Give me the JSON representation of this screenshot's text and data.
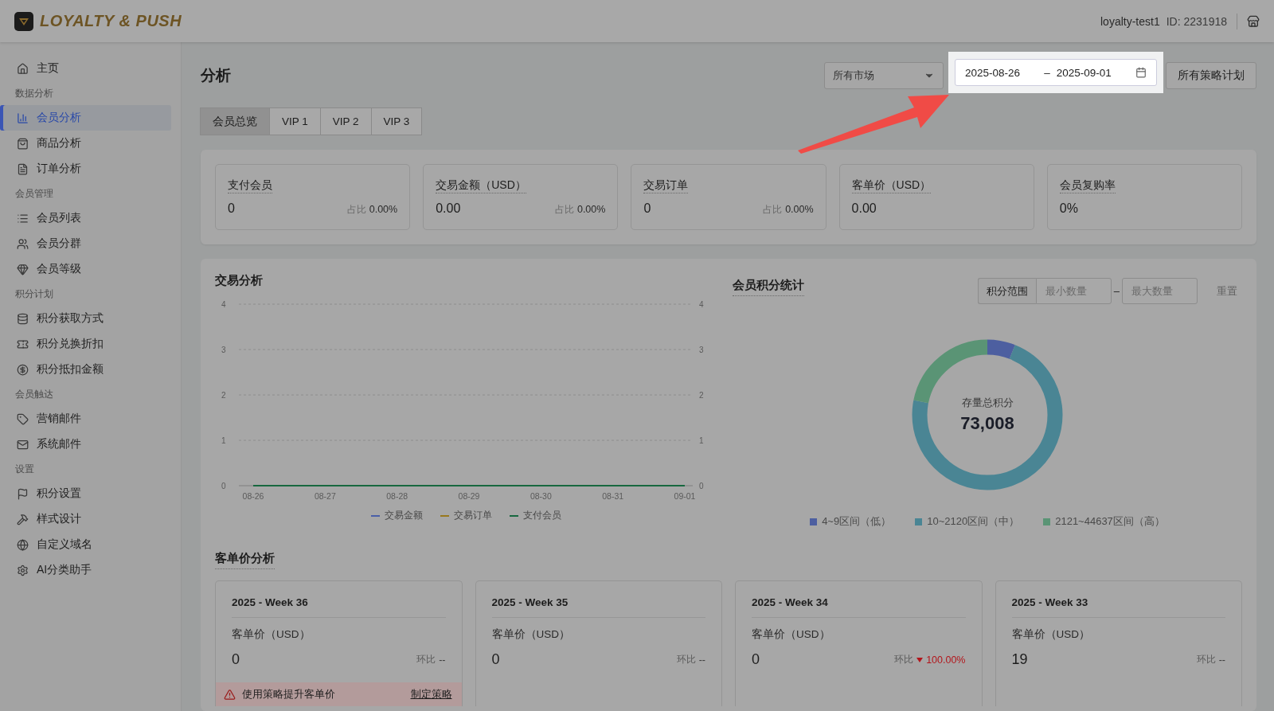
{
  "header": {
    "brand": "LOYALTY & PUSH",
    "account": "loyalty-test1",
    "account_id": "ID: 2231918"
  },
  "sidebar": {
    "sections": [
      {
        "items": [
          {
            "label": "主页",
            "selected": false
          }
        ]
      },
      {
        "label": "数据分析",
        "items": [
          {
            "label": "会员分析",
            "selected": true
          },
          {
            "label": "商品分析",
            "selected": false
          },
          {
            "label": "订单分析",
            "selected": false
          }
        ]
      },
      {
        "label": "会员管理",
        "items": [
          {
            "label": "会员列表",
            "selected": false
          },
          {
            "label": "会员分群",
            "selected": false
          },
          {
            "label": "会员等级",
            "selected": false
          }
        ]
      },
      {
        "label": "积分计划",
        "items": [
          {
            "label": "积分获取方式",
            "selected": false
          },
          {
            "label": "积分兑换折扣",
            "selected": false
          },
          {
            "label": "积分抵扣金额",
            "selected": false
          }
        ]
      },
      {
        "label": "会员触达",
        "items": [
          {
            "label": "营销邮件",
            "selected": false
          },
          {
            "label": "系统邮件",
            "selected": false
          }
        ]
      },
      {
        "label": "设置",
        "items": [
          {
            "label": "积分设置",
            "selected": false
          },
          {
            "label": "样式设计",
            "selected": false
          },
          {
            "label": "自定义域名",
            "selected": false
          },
          {
            "label": "AI分类助手",
            "selected": false
          }
        ]
      }
    ]
  },
  "page": {
    "title": "分析",
    "market_select": "所有市场",
    "date_start": "2025-08-26",
    "date_separator": "–",
    "date_end": "2025-09-01",
    "plan_button": "所有策略计划"
  },
  "tabs": [
    {
      "label": "会员总览",
      "selected": true
    },
    {
      "label": "VIP 1",
      "selected": false
    },
    {
      "label": "VIP 2",
      "selected": false
    },
    {
      "label": "VIP 3",
      "selected": false
    }
  ],
  "kpis": [
    {
      "label": "支付会员",
      "value": "0",
      "share_label": "占比",
      "share": "0.00%"
    },
    {
      "label": "交易金额（USD）",
      "value": "0.00",
      "share_label": "占比",
      "share": "0.00%"
    },
    {
      "label": "交易订单",
      "value": "0",
      "share_label": "占比",
      "share": "0.00%"
    },
    {
      "label": "客单价（USD）",
      "value": "0.00"
    },
    {
      "label": "会员复购率",
      "value": "0%"
    }
  ],
  "transactions": {
    "title": "交易分析",
    "right_axis_ticks": [
      "4",
      "3",
      "2",
      "1",
      "0"
    ],
    "chart_data": {
      "type": "line",
      "grid": true,
      "categories": [
        "08-26",
        "08-27",
        "08-28",
        "08-29",
        "08-30",
        "08-31",
        "09-01"
      ],
      "ylim": [
        0,
        4
      ],
      "yticks": [
        0,
        1,
        2,
        3,
        4
      ],
      "series": [
        {
          "name": "支付会员",
          "color": "#17683f",
          "values": [
            0,
            0,
            0,
            0,
            0,
            0,
            0
          ]
        }
      ]
    },
    "legend": [
      {
        "label": "交易金额",
        "color": "#4a5fa8"
      },
      {
        "label": "交易订单",
        "color": "#98781c"
      }
    ]
  },
  "points": {
    "title": "会员积分统计",
    "range_label": "积分范围",
    "min_placeholder": "最小数量",
    "range_separator": "–",
    "max_placeholder": "最大数量",
    "reset": "重置",
    "center_label": "存量总积分",
    "total": "73,008",
    "legend": [
      {
        "label": "4~9区间（低）",
        "color": "#4d5fa0"
      },
      {
        "label": "10~2120区间（中）",
        "color": "#4a8594"
      },
      {
        "label": "2121~44637区间（高）",
        "color": "#5a9475"
      }
    ]
  },
  "aov": {
    "title": "客单价分析",
    "weeks": [
      {
        "title": "2025 - Week 36",
        "label": "客单价（USD）",
        "value": "0",
        "change_label": "环比",
        "change": "--",
        "kind": "flat",
        "alert": "使用策略提升客单价",
        "alert_link": "制定策略"
      },
      {
        "title": "2025 - Week 35",
        "label": "客单价（USD）",
        "value": "0",
        "change_label": "环比",
        "change": "--",
        "kind": "flat"
      },
      {
        "title": "2025 - Week 34",
        "label": "客单价（USD）",
        "value": "0",
        "change_label": "环比",
        "change": "100.00%",
        "kind": "down"
      },
      {
        "title": "2025 - Week 33",
        "label": "客单价（USD）",
        "value": "19",
        "change_label": "环比",
        "change": "--",
        "kind": "flat"
      }
    ]
  }
}
